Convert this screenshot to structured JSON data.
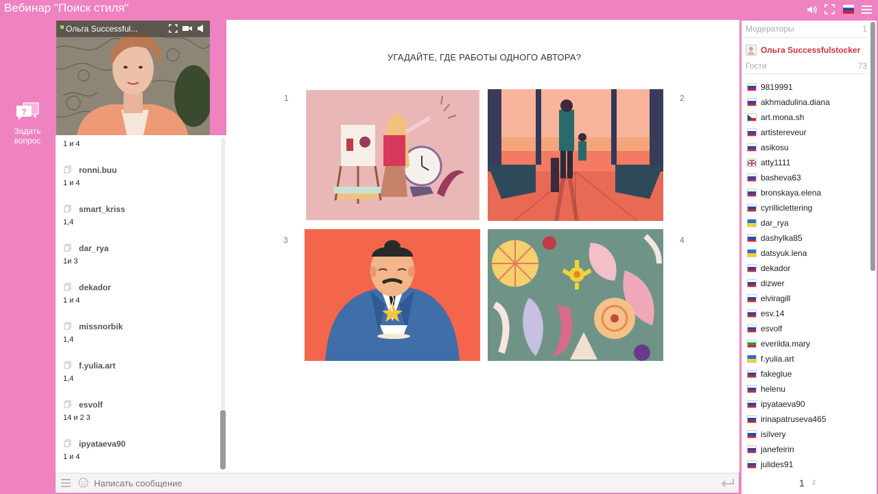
{
  "window": {
    "title": "Вебинар \"Поиск стиля\""
  },
  "top_icons": [
    "speaker-icon",
    "fullscreen-icon",
    "russia-flag-icon",
    "menu-icon"
  ],
  "ask_question": {
    "label": "Задать вопрос"
  },
  "video": {
    "presenter_name": "Ольга Successful...",
    "icons": [
      "expand-icon",
      "camera-icon",
      "volume-icon"
    ]
  },
  "chat": {
    "first_partial_msg": "1 и 4",
    "items": [
      {
        "user": "ronni.buu",
        "msg": "1 и 4"
      },
      {
        "user": "smart_kriss",
        "msg": "1,4"
      },
      {
        "user": "dar_rya",
        "msg": "1и 3"
      },
      {
        "user": "dekador",
        "msg": "1 и 4"
      },
      {
        "user": "missnorbik",
        "msg": "1,4"
      },
      {
        "user": "f.yulia.art",
        "msg": "1,4"
      },
      {
        "user": "esvolf",
        "msg": "14 и 2 3"
      },
      {
        "user": "ipyataeva90",
        "msg": "1 и 4"
      }
    ]
  },
  "slide": {
    "title": "УГАДАЙТЕ, ГДЕ РАБОТЫ ОДНОГО АВТОРА?",
    "numbers": [
      "1",
      "2",
      "3",
      "4"
    ]
  },
  "message_bar": {
    "placeholder": "Написать сообщение"
  },
  "panel": {
    "moderators_label": "Модераторы",
    "moderators_count": "1",
    "moderator_name": "Ольга Successfulstocker",
    "guests_label": "Гости",
    "guests_count": "73",
    "guests": [
      {
        "name": "9819991",
        "flag": "ru"
      },
      {
        "name": "akhmadulina.diana",
        "flag": "ru"
      },
      {
        "name": "art.mona.sh",
        "flag": "cz"
      },
      {
        "name": "artistereveur",
        "flag": "ru"
      },
      {
        "name": "asikosu",
        "flag": "ru"
      },
      {
        "name": "atty1111",
        "flag": "gb"
      },
      {
        "name": "basheva63",
        "flag": "ru"
      },
      {
        "name": "bronskaya.elena",
        "flag": "ru"
      },
      {
        "name": "cyrilliclettering",
        "flag": "ru"
      },
      {
        "name": "dar_rya",
        "flag": "ua"
      },
      {
        "name": "dashylka85",
        "flag": "ru"
      },
      {
        "name": "datsyuk.lena",
        "flag": "ua"
      },
      {
        "name": "dekador",
        "flag": "ru"
      },
      {
        "name": "dizwer",
        "flag": "ru"
      },
      {
        "name": "elviragill",
        "flag": "ru"
      },
      {
        "name": "esv.14",
        "flag": "ru"
      },
      {
        "name": "esvolf",
        "flag": "ru"
      },
      {
        "name": "everilda.mary",
        "flag": "bg"
      },
      {
        "name": "f.yulia.art",
        "flag": "ua"
      },
      {
        "name": "fakeglue",
        "flag": "ru"
      },
      {
        "name": "helenu",
        "flag": "ru"
      },
      {
        "name": "ipyataeva90",
        "flag": "ru"
      },
      {
        "name": "irinapatruseva465",
        "flag": "ru"
      },
      {
        "name": "isilvery",
        "flag": "ru"
      },
      {
        "name": "janefeirin",
        "flag": "ru"
      },
      {
        "name": "julides91",
        "flag": "ru"
      }
    ],
    "pages": [
      "1",
      "2"
    ]
  }
}
